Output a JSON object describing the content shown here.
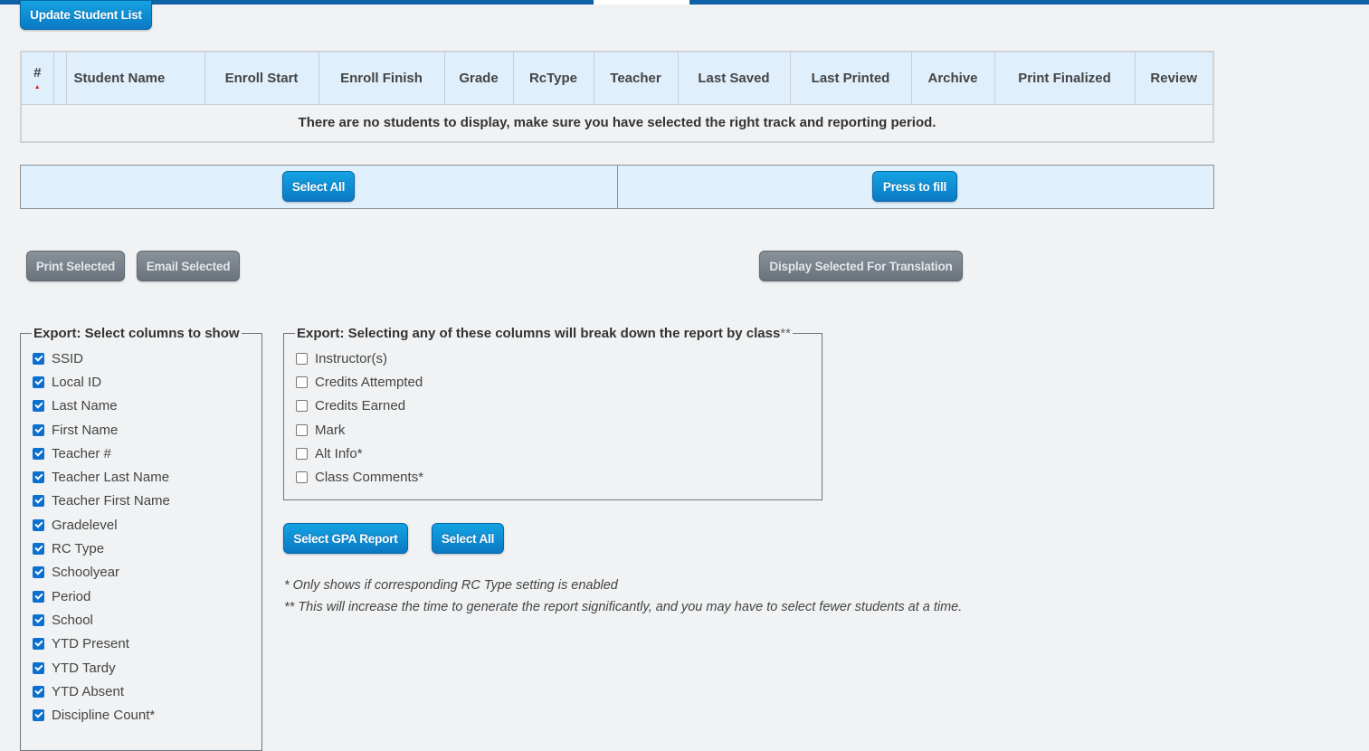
{
  "toolbar": {
    "update_label": "Update Student List"
  },
  "table": {
    "sort_col": "#",
    "columns": [
      "Student Name",
      "Enroll Start",
      "Enroll Finish",
      "Grade",
      "RcType",
      "Teacher",
      "Last Saved",
      "Last Printed",
      "Archive",
      "Print Finalized",
      "Review"
    ],
    "empty_message": "There are no students to display, make sure you have selected the right track and reporting period."
  },
  "fill": {
    "select_all_label": "Select All",
    "press_fill_label": "Press to fill"
  },
  "actions": {
    "print_label": "Print Selected",
    "email_label": "Email Selected",
    "translate_label": "Display Selected For Translation"
  },
  "export_columns": {
    "legend": "Export:  Select columns to show",
    "items": [
      {
        "label": "SSID",
        "checked": true
      },
      {
        "label": "Local ID",
        "checked": true
      },
      {
        "label": "Last Name",
        "checked": true
      },
      {
        "label": "First Name",
        "checked": true
      },
      {
        "label": "Teacher #",
        "checked": true
      },
      {
        "label": "Teacher Last Name",
        "checked": true
      },
      {
        "label": "Teacher First Name",
        "checked": true
      },
      {
        "label": "Gradelevel",
        "checked": true
      },
      {
        "label": "RC Type",
        "checked": true
      },
      {
        "label": "Schoolyear",
        "checked": true
      },
      {
        "label": "Period",
        "checked": true
      },
      {
        "label": "School",
        "checked": true
      },
      {
        "label": "YTD Present",
        "checked": true
      },
      {
        "label": "YTD Tardy",
        "checked": true
      },
      {
        "label": "YTD Absent",
        "checked": true
      },
      {
        "label": "Discipline Count*",
        "checked": true
      }
    ]
  },
  "export_class": {
    "legend": "Export:  Selecting any of these columns will break down the report by class",
    "legend_suffix": "**",
    "items": [
      {
        "label": "Instructor(s)",
        "checked": false
      },
      {
        "label": "Credits Attempted",
        "checked": false
      },
      {
        "label": "Credits Earned",
        "checked": false
      },
      {
        "label": "Mark",
        "checked": false
      },
      {
        "label": "Alt Info*",
        "checked": false
      },
      {
        "label": "Class Comments*",
        "checked": false
      }
    ]
  },
  "bottom_buttons": {
    "gpa_label": "Select GPA Report",
    "select_all_label": "Select All"
  },
  "notes": [
    "* Only shows if corresponding RC Type setting is enabled",
    "** This will increase the time to generate the report significantly, and you may have to select fewer students at a time."
  ],
  "colors": {
    "accent_blue": "#0a79c4",
    "header_bg": "#dfeffc",
    "disabled_gray": "#6a737c"
  }
}
